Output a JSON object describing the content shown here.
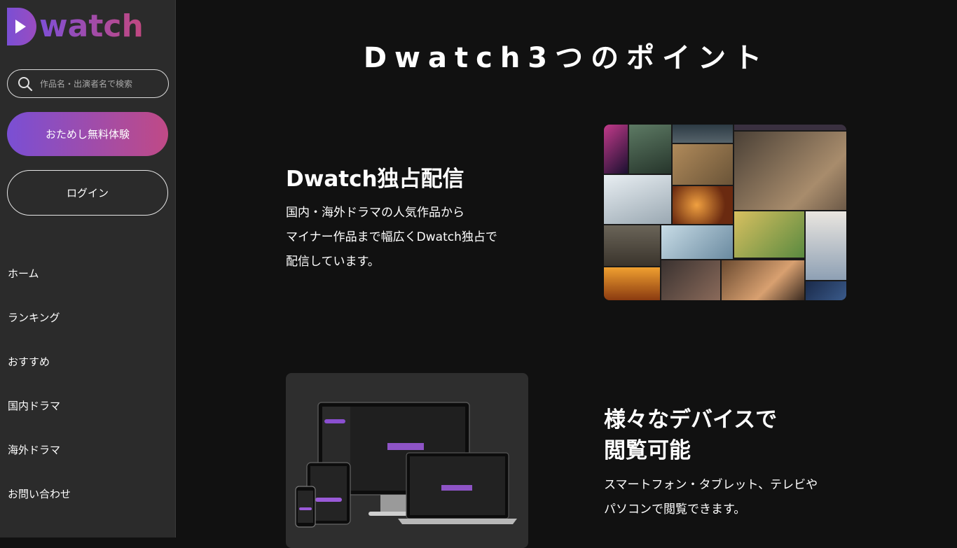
{
  "brand": {
    "name": "watch",
    "logo_letter": "D"
  },
  "sidebar": {
    "search_placeholder": "作品名・出演者名で検索",
    "trial_label": "おためし無料体験",
    "login_label": "ログイン",
    "nav": [
      {
        "label": "ホーム"
      },
      {
        "label": "ランキング"
      },
      {
        "label": "おすすめ"
      },
      {
        "label": "国内ドラマ"
      },
      {
        "label": "海外ドラマ"
      },
      {
        "label": "お問い合わせ"
      }
    ]
  },
  "main": {
    "title": "Dwatch3つのポイント",
    "feature1": {
      "title": "Dwatch独占配信",
      "lines": [
        "国内・海外ドラマの人気作品から",
        "マイナー作品まで幅広くDwatch独占で",
        "配信しています。"
      ]
    },
    "feature2": {
      "title_lines": [
        "様々なデバイスで",
        "閲覧可能"
      ],
      "lines": [
        "スマートフォン・タブレット、テレビや",
        "パソコンで閲覧できます。"
      ]
    }
  },
  "colors": {
    "accent_purple": "#7a4fd4",
    "accent_pink": "#c04a86",
    "sidebar_bg": "#2b2b2b",
    "main_bg": "#111111"
  },
  "icons": {
    "search": "search-icon",
    "play": "play-icon"
  }
}
